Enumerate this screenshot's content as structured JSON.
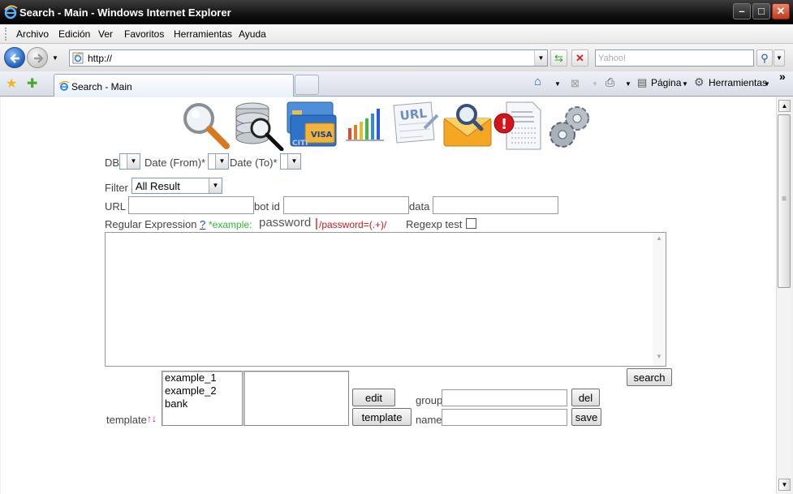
{
  "window": {
    "title": "Search - Main - Windows Internet Explorer",
    "minimize": "–",
    "maximize": "□",
    "close": "✕"
  },
  "menu": [
    "Archivo",
    "Edición",
    "Ver",
    "Favoritos",
    "Herramientas",
    "Ayuda"
  ],
  "address": {
    "url": "http://"
  },
  "search": {
    "placeholder": "Yahoo!"
  },
  "tab": {
    "label": "Search - Main"
  },
  "commands": {
    "page": "Página",
    "tools": "Herramientas",
    "more": "»"
  },
  "toolbar_icons": [
    "search-icon",
    "database-search-icon",
    "credit-cards-icon",
    "bar-chart-icon",
    "url-icon",
    "mail-search-icon",
    "alert-document-icon",
    "settings-gears-icon"
  ],
  "form": {
    "db_label": "DB",
    "date_from_label": "Date (From)*",
    "date_to_label": "Date (To)*",
    "filter_label": "Filter",
    "filter_value": "All Result",
    "url_label": "URL",
    "bot_id_label": "bot id",
    "data_label": "data",
    "regex_label": "Regular Expression",
    "regex_help": "?",
    "example_label": "*example:",
    "example_word": "password",
    "example_regex": "/password=(.+)/",
    "regexp_test_label": "Regexp test",
    "regex_text": ""
  },
  "templates": {
    "label": "template",
    "sort_arrows": "↑↓",
    "items": [
      "example_1",
      "example_2",
      "bank"
    ],
    "edit_button": "edit",
    "template_button": "template",
    "group_label": "group",
    "name_label": "name",
    "del_button": "del",
    "save_button": "save",
    "search_button": "search"
  }
}
